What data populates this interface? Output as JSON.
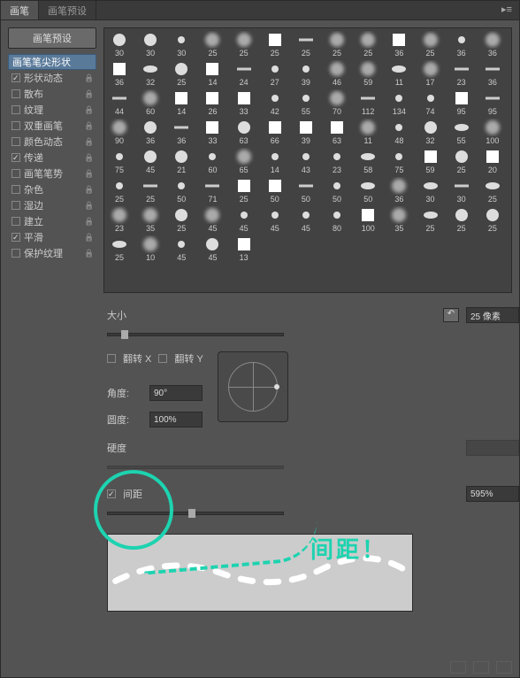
{
  "tabs": {
    "brush": "画笔",
    "presets": "画笔预设"
  },
  "preset_button": "画笔预设",
  "sidebar": {
    "items": [
      {
        "label": "画笔笔尖形状",
        "selected": true,
        "checkbox": false,
        "lock": false
      },
      {
        "label": "形状动态",
        "checked": true,
        "lock": true
      },
      {
        "label": "散布",
        "checked": false,
        "lock": true
      },
      {
        "label": "纹理",
        "checked": false,
        "lock": true
      },
      {
        "label": "双重画笔",
        "checked": false,
        "lock": true
      },
      {
        "label": "颜色动态",
        "checked": false,
        "lock": true
      },
      {
        "label": "传递",
        "checked": true,
        "lock": true
      },
      {
        "label": "画笔笔势",
        "checked": false,
        "lock": true
      },
      {
        "label": "杂色",
        "checked": false,
        "lock": true
      },
      {
        "label": "湿边",
        "checked": false,
        "lock": true
      },
      {
        "label": "建立",
        "checked": false,
        "lock": true
      },
      {
        "label": "平滑",
        "checked": true,
        "lock": true
      },
      {
        "label": "保护纹理",
        "checked": false,
        "lock": true
      }
    ]
  },
  "brushes": [
    [
      30,
      30,
      30,
      25,
      25,
      25,
      25,
      25,
      25,
      36,
      25,
      36,
      36
    ],
    [
      36,
      32,
      25,
      14,
      24,
      27,
      39,
      46,
      59,
      11,
      17,
      23,
      36
    ],
    [
      44,
      60,
      14,
      26,
      33,
      42,
      55,
      70,
      112,
      134,
      74,
      95,
      95
    ],
    [
      90,
      36,
      36,
      33,
      63,
      66,
      39,
      63,
      11,
      48,
      32,
      55,
      100
    ],
    [
      75,
      45,
      21,
      60,
      65,
      14,
      43,
      23,
      58,
      75,
      59,
      25,
      20
    ],
    [
      25,
      25,
      50,
      71,
      25,
      50,
      50,
      50,
      50,
      36,
      30,
      30,
      25
    ],
    [
      23,
      35,
      25,
      45,
      45,
      45,
      45,
      80,
      100,
      35,
      25,
      25,
      25
    ],
    [
      25,
      10,
      45,
      45,
      13
    ]
  ],
  "controls": {
    "size_label": "大小",
    "size_value": "25 像素",
    "flip_x": "翻转 X",
    "flip_y": "翻转 Y",
    "angle_label": "角度:",
    "angle_value": "90°",
    "roundness_label": "圆度:",
    "roundness_value": "100%",
    "hardness_label": "硬度",
    "spacing_label": "间距",
    "spacing_value": "595%"
  },
  "annotation": "间距！"
}
